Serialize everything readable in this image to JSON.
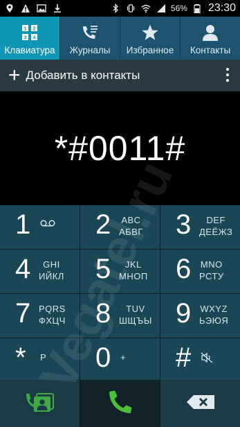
{
  "status_bar": {
    "battery_percent": "56%",
    "time": "23:30"
  },
  "tabs": [
    {
      "label": "Клавиатура",
      "icon": "dialpad-icon",
      "active": true
    },
    {
      "label": "Журналы",
      "icon": "call-log-icon",
      "active": false
    },
    {
      "label": "Избранное",
      "icon": "star-icon",
      "active": false
    },
    {
      "label": "Контакты",
      "icon": "person-icon",
      "active": false
    }
  ],
  "add_contact": {
    "label": "Добавить в контакты"
  },
  "display": {
    "number": "*#0011#"
  },
  "keypad": [
    {
      "digit": "1",
      "sub1": "",
      "sub2": "",
      "icon": "voicemail-icon"
    },
    {
      "digit": "2",
      "sub1": "ABC",
      "sub2": "АБВГ"
    },
    {
      "digit": "3",
      "sub1": "DEF",
      "sub2": "ДЕЁЖЗ"
    },
    {
      "digit": "4",
      "sub1": "GHI",
      "sub2": "ИЙКЛ"
    },
    {
      "digit": "5",
      "sub1": "JKL",
      "sub2": "МНОП"
    },
    {
      "digit": "6",
      "sub1": "MNO",
      "sub2": "РСТУ"
    },
    {
      "digit": "7",
      "sub1": "PQRS",
      "sub2": "ФХЦЧ"
    },
    {
      "digit": "8",
      "sub1": "TUV",
      "sub2": "ШЩЪЫ"
    },
    {
      "digit": "9",
      "sub1": "WXYZ",
      "sub2": "ЬЭЮЯ"
    },
    {
      "digit": "*",
      "sub1": "P",
      "sub2": ""
    },
    {
      "digit": "0",
      "sub1": "+",
      "sub2": ""
    },
    {
      "digit": "#",
      "sub1": "",
      "sub2": "",
      "icon": "mute-icon"
    }
  ],
  "watermark": "Vegatel.ru",
  "colors": {
    "tab_bar": "#1c5470",
    "tab_active": "#0f96b5",
    "key": "#1b4656",
    "call_green": "#4cc03a",
    "contact_green": "#3fa845"
  }
}
